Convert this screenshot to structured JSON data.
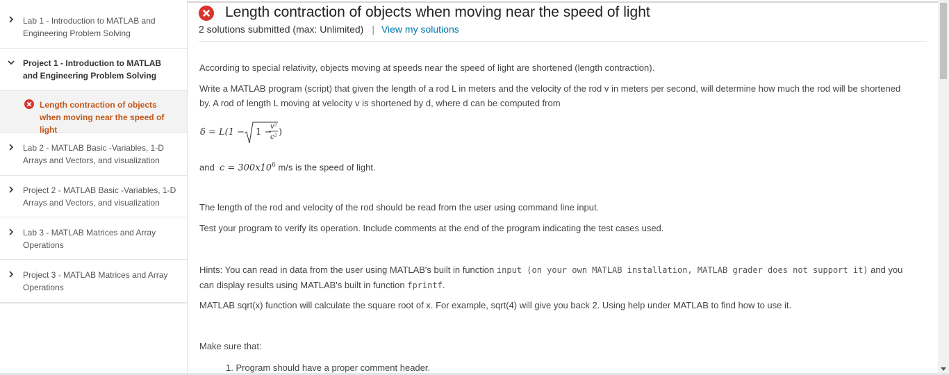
{
  "sidebar": {
    "items": [
      {
        "label": "Lab 1 - Introduction to MATLAB and Engineering Problem Solving"
      },
      {
        "label": "Project 1 - Introduction to MATLAB and Engineering Problem Solving"
      },
      {
        "label": "Length contraction of objects when moving near the speed of light"
      },
      {
        "label": "Lab 2 - MATLAB Basic -Variables, 1-D Arrays and Vectors, and visualization"
      },
      {
        "label": "Project 2 - MATLAB Basic -Variables, 1-D Arrays and Vectors, and visualization"
      },
      {
        "label": "Lab 3 - MATLAB Matrices and Array Operations"
      },
      {
        "label": "Project 3 - MATLAB Matrices and Array Operations"
      }
    ]
  },
  "header": {
    "title": "Length contraction of objects when moving near the speed of light",
    "submitted": "2 solutions submitted (max: Unlimited)",
    "separator": "|",
    "view_link": "View my solutions"
  },
  "content": {
    "p1": "According to special relativity, objects moving at speeds near the speed of light are shortened (length contraction).",
    "p2": "Write a MATLAB program (script) that given the length of a rod L in meters and the velocity of the rod v in meters per second, will determine how much the rod will be shortened by. A rod of length L moving at velocity v is shortened by d, where d can be computed from",
    "and_text": "and",
    "c_eq": "c = 300x10",
    "c_exp": "6",
    "c_tail": "m/s is the speed of light.",
    "p3": "The length of the rod and velocity of the rod should be read from the user using command line input.",
    "p4": "Test your program to verify its operation. Include comments at the end of the program indicating the test cases used.",
    "hints_a": "Hints: You can read in data from the user using MATLAB's built in function",
    "hints_code": "input (on your own MATLAB installation, MATLAB grader does not support it)",
    "hints_b": "and you can display results using MATLAB's built in function",
    "hints_code2": "fprintf",
    "hints_end": ".",
    "p5": "MATLAB sqrt(x) function will calculate the square root of x. For example, sqrt(4) will give you back 2. Using help under MATLAB to find how to use it.",
    "make_sure": "Make sure that:",
    "list_item1": "1. Program should have a proper comment header."
  },
  "colors": {
    "error_red": "#d9342b",
    "link_blue": "#0076a8",
    "active_orange": "#c2571a"
  }
}
